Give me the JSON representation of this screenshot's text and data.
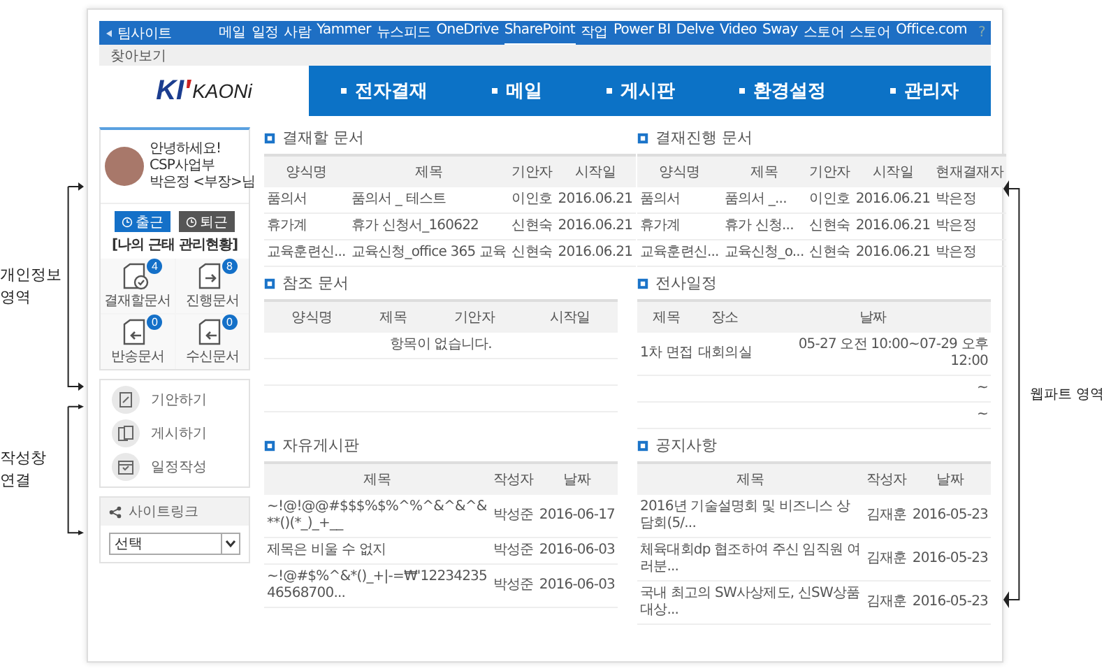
{
  "annotations": {
    "left": [
      {
        "label": "개인정보 영역"
      },
      {
        "label": "작성창 연결"
      }
    ],
    "right": [
      {
        "label": "웹파트 영역"
      }
    ]
  },
  "suite_bar": {
    "back_label": "팀사이트",
    "items": [
      {
        "label": "메일",
        "selected": false
      },
      {
        "label": "일정",
        "selected": false
      },
      {
        "label": "사람",
        "selected": false
      },
      {
        "label": "Yammer",
        "selected": false
      },
      {
        "label": "뉴스피드",
        "selected": false
      },
      {
        "label": "OneDrive",
        "selected": false
      },
      {
        "label": "SharePoint",
        "selected": true
      },
      {
        "label": "작업",
        "selected": false
      },
      {
        "label": "Power BI",
        "selected": false
      },
      {
        "label": "Delve",
        "selected": false
      },
      {
        "label": "Video",
        "selected": false
      },
      {
        "label": "Sway",
        "selected": false
      },
      {
        "label": "스토어",
        "selected": false
      },
      {
        "label": "스토어",
        "selected": false
      },
      {
        "label": "Office.com",
        "selected": false
      }
    ],
    "help": "?"
  },
  "browse_bar": {
    "label": "찾아보기"
  },
  "logo": {
    "mark": "KI",
    "name": "KAONi"
  },
  "nav": [
    "전자결재",
    "메일",
    "게시판",
    "환경설정",
    "관리자"
  ],
  "profile": {
    "greeting": "안녕하세요!",
    "department": "CSP사업부",
    "name": "박은정 <부장>님"
  },
  "attendance": {
    "buttons": [
      {
        "label": "출근",
        "kind": "primary"
      },
      {
        "label": "퇴근",
        "kind": "dark"
      }
    ],
    "title": "[나의 근태 관리현황]"
  },
  "doc_counts": [
    {
      "label": "결재할문서",
      "count": "4",
      "kind": "check"
    },
    {
      "label": "진행문서",
      "count": "8",
      "kind": "forward"
    },
    {
      "label": "반송문서",
      "count": "0",
      "kind": "back"
    },
    {
      "label": "수신문서",
      "count": "0",
      "kind": "back"
    }
  ],
  "quick_links": [
    {
      "label": "기안하기",
      "kind": "draft"
    },
    {
      "label": "게시하기",
      "kind": "post"
    },
    {
      "label": "일정작성",
      "kind": "calendar"
    }
  ],
  "site_link": {
    "title": "사이트링크",
    "select_value": "선택"
  },
  "webparts": [
    {
      "title": "결재할 문서",
      "columns": [
        "양식명",
        "제목",
        "기안자",
        "시작일"
      ],
      "rows": [
        [
          "품의서",
          "품의서 _ 테스트",
          "이인호",
          "2016.06.21"
        ],
        [
          "휴가계",
          "휴가 신청서_160622",
          "신현숙",
          "2016.06.21"
        ],
        [
          "교육훈련신...",
          "교육신청_office 365 교육",
          "신현숙",
          "2016.06.21"
        ]
      ]
    },
    {
      "title": "결재진행 문서",
      "columns": [
        "양식명",
        "제목",
        "기안자",
        "시작일",
        "현재결재자"
      ],
      "rows": [
        [
          "품의서",
          "품의서 _...",
          "이인호",
          "2016.06.21",
          "박은정"
        ],
        [
          "휴가계",
          "휴가 신청...",
          "신현숙",
          "2016.06.21",
          "박은정"
        ],
        [
          "교육훈련신...",
          "교육신청_o...",
          "신현숙",
          "2016.06.21",
          "박은정"
        ]
      ]
    },
    {
      "title": "참조 문서",
      "columns": [
        "양식명",
        "제목",
        "기안자",
        "시작일"
      ],
      "empty_message": "항목이 없습니다."
    },
    {
      "title": "전사일정",
      "columns": [
        "제목",
        "장소",
        "날짜"
      ],
      "rows": [
        [
          "1차 면접",
          "대회의실",
          "05-27 오전 10:00~07-29 오후 12:00"
        ],
        [
          null,
          null,
          "~"
        ],
        [
          null,
          null,
          "~"
        ]
      ]
    },
    {
      "title": "자유게시판",
      "columns": [
        "제목",
        "작성자",
        "날짜"
      ],
      "rows": [
        [
          "~!@!@@#$$$%$%^%^&^&^&**()(*_)_+__",
          "박성준",
          "2016-06-17"
        ],
        [
          "제목은 비울 수 없지",
          "박성준",
          "2016-06-03"
        ],
        [
          "~!@#$%^&*()_+|-=₩'1223423546568700...",
          "박성준",
          "2016-06-03"
        ]
      ]
    },
    {
      "title": "공지사항",
      "columns": [
        "제목",
        "작성자",
        "날짜"
      ],
      "rows": [
        [
          "2016년 기술설명회 및 비즈니스 상담회(5/...",
          "김재훈",
          "2016-05-23"
        ],
        [
          "체육대회dp 협조하여 주신 임직원 여러분...",
          "김재훈",
          "2016-05-23"
        ],
        [
          "국내 최고의 SW사상제도, 신SW상품대상...",
          "김재훈",
          "2016-05-23"
        ]
      ]
    }
  ]
}
